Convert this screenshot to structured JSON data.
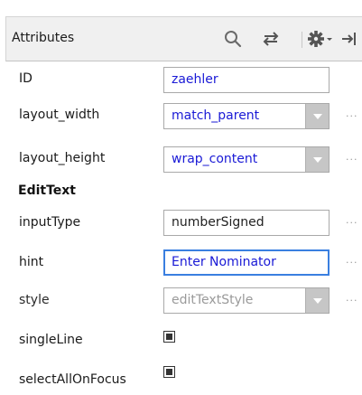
{
  "header": {
    "title": "Attributes",
    "icons": [
      "search-icon",
      "swap-icon",
      "gear-icon",
      "collapse-icon"
    ]
  },
  "rows": {
    "id": {
      "label": "ID",
      "value": "zaehler"
    },
    "layout_width": {
      "label": "layout_width",
      "value": "match_parent"
    },
    "layout_height": {
      "label": "layout_height",
      "value": "wrap_content"
    }
  },
  "section_title": "EditText",
  "edittext": {
    "inputType": {
      "label": "inputType",
      "value": "numberSigned"
    },
    "hint": {
      "label": "hint",
      "value": "Enter Nominator"
    },
    "style": {
      "label": "style",
      "value": "editTextStyle"
    },
    "singleLine": {
      "label": "singleLine",
      "checked": true
    },
    "selectAllOnFocus": {
      "label": "selectAllOnFocus",
      "checked": true
    }
  },
  "more_label": "...",
  "colors": {
    "value_blue": "#1a1ad6",
    "focus_border": "#3a7fe0",
    "header_bg": "#f0f0f0",
    "dropdown_button": "#c6c6c6"
  }
}
